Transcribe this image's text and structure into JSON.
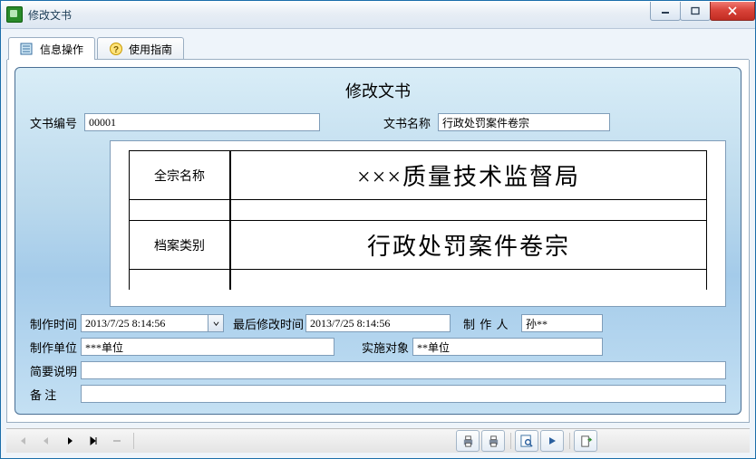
{
  "window": {
    "title": "修改文书"
  },
  "tabs": {
    "info": "信息操作",
    "guide": "使用指南"
  },
  "panel": {
    "title": "修改文书"
  },
  "fields": {
    "doc_no_label": "文书编号",
    "doc_no_value": "00001",
    "doc_name_label": "文书名称",
    "doc_name_value": "行政处罚案件卷宗",
    "create_time_label": "制作时间",
    "create_time_value": "2013/7/25 8:14:56",
    "last_mod_label": "最后修改时间",
    "last_mod_value": "2013/7/25 8:14:56",
    "creator_label": "制 作 人",
    "creator_value": "孙**",
    "unit_label": "制作单位",
    "unit_value": "***单位",
    "target_label": "实施对象",
    "target_value": "**单位",
    "desc_label": "简要说明",
    "desc_value": "",
    "remark_label": "备    注",
    "remark_value": ""
  },
  "document": {
    "full_name_label": "全宗名称",
    "full_name_value": "×××质量技术监督局",
    "archive_type_label": "档案类别",
    "archive_type_value": "行政处罚案件卷宗"
  }
}
